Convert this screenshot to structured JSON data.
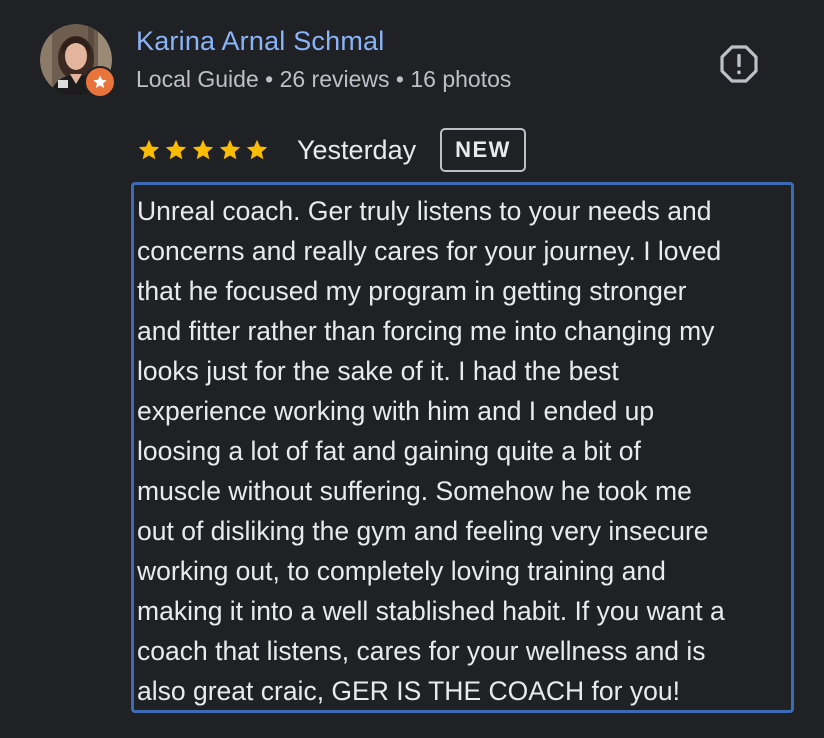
{
  "reviewer": {
    "name": "Karina Arnal Schmal",
    "meta": "Local Guide • 26 reviews • 16 photos",
    "avatar_icon": "user-avatar-photo",
    "badge_icon": "local-guide-star-icon"
  },
  "actions": {
    "report_icon": "report-exclamation-icon"
  },
  "rating": {
    "stars": 5,
    "max": 5,
    "star_color": "#fbbc04",
    "date": "Yesterday",
    "badge": "NEW"
  },
  "review": {
    "text": "Unreal coach. Ger truly listens to your needs and\nconcerns and really cares for your journey. I loved\nthat he focused my program in getting stronger\nand fitter rather than forcing me into changing my\nlooks just for the sake of it. I had the best\nexperience working with him and I ended up\nloosing a lot of fat and gaining quite a bit of\nmuscle without suffering. Somehow he took me\nout of disliking the gym and feeling very insecure\nworking out, to completely loving training and\nmaking it into a well stablished habit. If you want a\ncoach that listens, cares for your wellness and is\nalso great craic, GER IS THE COACH for you!",
    "highlight_color": "#3b6bb5"
  },
  "colors": {
    "background": "#202124",
    "name": "#8ab4f8",
    "meta": "#bdc1c6",
    "text": "#e8eaed",
    "guide_badge": "#e8743b"
  }
}
